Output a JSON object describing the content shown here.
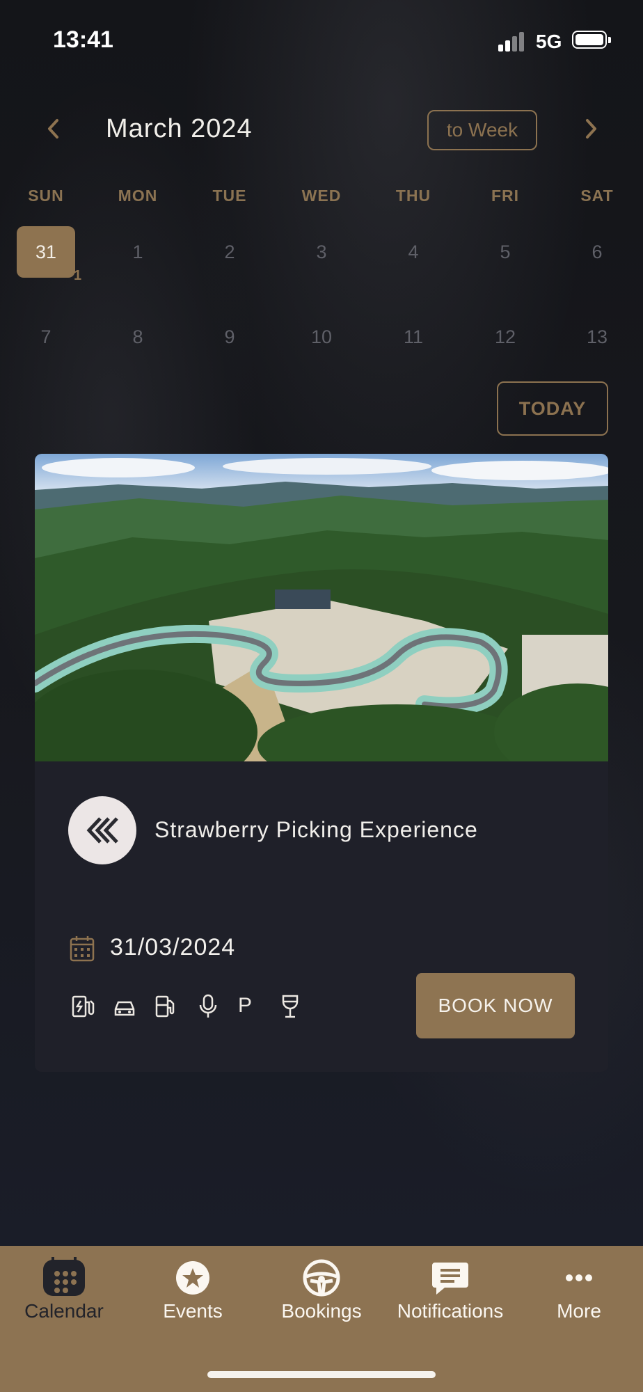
{
  "status_bar": {
    "time": "13:41",
    "network": "5G"
  },
  "calendar": {
    "month_label": "March 2024",
    "view_toggle": "to Week",
    "today_button": "TODAY",
    "weekdays": [
      "SUN",
      "MON",
      "TUE",
      "WED",
      "THU",
      "FRI",
      "SAT"
    ],
    "week1": [
      "31",
      "1",
      "2",
      "3",
      "4",
      "5",
      "6"
    ],
    "week2": [
      "7",
      "8",
      "9",
      "10",
      "11",
      "12",
      "13"
    ],
    "selected_event_count": "1"
  },
  "event_card": {
    "title": "Strawberry Picking Experience",
    "date": "31/03/2024",
    "amenity_p": "P",
    "book_button": "BOOK NOW",
    "amenity_icons": [
      "ev-charger-icon",
      "car-icon",
      "fuel-pump-icon",
      "microphone-icon",
      "parking-icon",
      "wine-glass-icon"
    ]
  },
  "tabbar": {
    "calendar": "Calendar",
    "events": "Events",
    "bookings": "Bookings",
    "notifications": "Notifications",
    "more": "More"
  },
  "colors": {
    "accent": "#8e7350",
    "background": "#141519",
    "card": "#1f2029",
    "tabbar": "#8d7352"
  }
}
